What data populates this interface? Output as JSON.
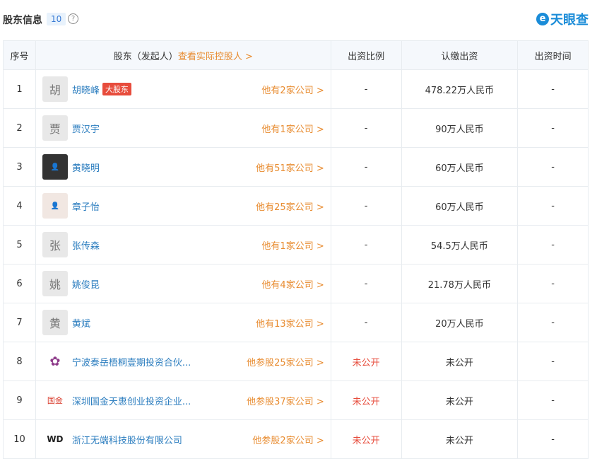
{
  "header": {
    "title": "股东信息",
    "count": "10",
    "help": "?",
    "brand": "天眼查",
    "brand_icon": "e"
  },
  "columns": {
    "index": "序号",
    "shareholder": "股东（发起人）",
    "controller_link": "查看实际控股人 >",
    "ratio": "出资比例",
    "subscribed": "认缴出资",
    "time": "出资时间"
  },
  "rows": [
    {
      "index": "1",
      "avatar": "胡",
      "name": "胡晓峰",
      "badge": "大股东",
      "more": "他有2家公司 >",
      "ratio": "-",
      "subscribed": "478.22万人民币",
      "time": "-"
    },
    {
      "index": "2",
      "avatar": "贾",
      "name": "贾汉宇",
      "more": "他有1家公司 >",
      "ratio": "-",
      "subscribed": "90万人民币",
      "time": "-"
    },
    {
      "index": "3",
      "avatar": "",
      "name": "黄晓明",
      "more": "他有51家公司 >",
      "ratio": "-",
      "subscribed": "60万人民币",
      "time": "-"
    },
    {
      "index": "4",
      "avatar": "",
      "name": "章子怡",
      "more": "他有25家公司 >",
      "ratio": "-",
      "subscribed": "60万人民币",
      "time": "-"
    },
    {
      "index": "5",
      "avatar": "张",
      "name": "张传森",
      "more": "他有1家公司 >",
      "ratio": "-",
      "subscribed": "54.5万人民币",
      "time": "-"
    },
    {
      "index": "6",
      "avatar": "姚",
      "name": "姚俊昆",
      "more": "他有4家公司 >",
      "ratio": "-",
      "subscribed": "21.78万人民币",
      "time": "-"
    },
    {
      "index": "7",
      "avatar": "黄",
      "name": "黄斌",
      "more": "他有13家公司 >",
      "ratio": "-",
      "subscribed": "20万人民币",
      "time": "-"
    },
    {
      "index": "8",
      "avatar": "",
      "name": "宁波泰岳梧桐壹期投资合伙...",
      "more": "他参股25家公司 >",
      "ratio": "未公开",
      "subscribed": "未公开",
      "time": "-"
    },
    {
      "index": "9",
      "avatar": "",
      "name": "深圳国金天惠创业投资企业...",
      "more": "他参股37家公司 >",
      "ratio": "未公开",
      "subscribed": "未公开",
      "time": "-"
    },
    {
      "index": "10",
      "avatar": "",
      "name": "浙江无端科技股份有限公司",
      "more": "他参股2家公司 >",
      "ratio": "未公开",
      "subscribed": "未公开",
      "time": "-"
    }
  ]
}
